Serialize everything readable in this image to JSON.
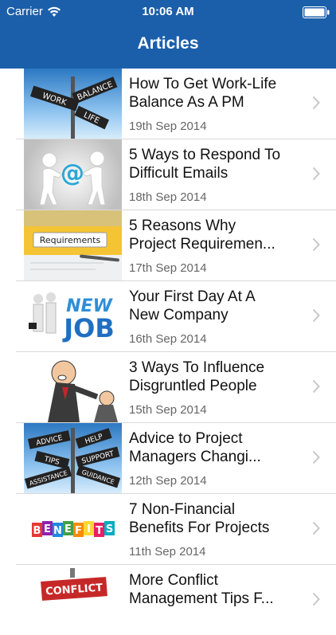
{
  "status_bar": {
    "carrier": "Carrier",
    "time": "10:06 AM"
  },
  "nav": {
    "title": "Articles"
  },
  "articles": [
    {
      "title_line1": "How To Get Work-Life",
      "title_line2": "Balance As A PM",
      "date": "19th Sep 2014",
      "thumb_text": [
        "WORK",
        "BALANCE",
        "LIFE"
      ]
    },
    {
      "title_line1": "5 Ways to Respond To",
      "title_line2": "Difficult Emails",
      "date": "18th Sep 2014",
      "thumb_text": [
        "@"
      ]
    },
    {
      "title_line1": "5 Reasons Why",
      "title_line2": "Project Requiremen...",
      "date": "17th Sep 2014",
      "thumb_text": [
        "Requirements"
      ]
    },
    {
      "title_line1": "Your First Day At A",
      "title_line2": "New Company",
      "date": "16th Sep 2014",
      "thumb_text": [
        "NEW",
        "JOB"
      ]
    },
    {
      "title_line1": "3 Ways To Influence",
      "title_line2": "Disgruntled People",
      "date": "15th Sep 2014",
      "thumb_text": []
    },
    {
      "title_line1": "Advice to Project",
      "title_line2": "Managers Changi...",
      "date": "12th Sep 2014",
      "thumb_text": [
        "ADVICE",
        "HELP",
        "TIPS",
        "SUPPORT",
        "ASSISTANCE",
        "GUIDANCE"
      ]
    },
    {
      "title_line1": "7 Non-Financial",
      "title_line2": "Benefits For Projects",
      "date": "11th Sep 2014",
      "thumb_text": [
        "B",
        "E",
        "N",
        "E",
        "F",
        "I",
        "T",
        "S"
      ]
    },
    {
      "title_line1": "More Conflict",
      "title_line2": "Management Tips F...",
      "date": "",
      "thumb_text": [
        "CONFLICT"
      ]
    }
  ]
}
